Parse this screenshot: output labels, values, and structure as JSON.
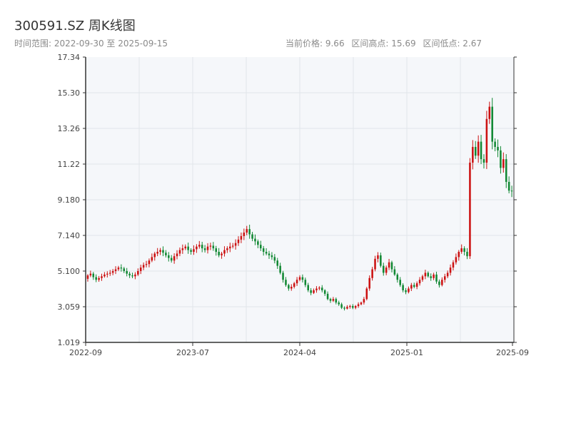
{
  "header": {
    "title": "300591.SZ 周K线图",
    "date_range_label": "时间范围: 2022-09-30 至 2025-09-15",
    "current_price": "当前价格: 9.66",
    "range_high": "区间高点: 15.69",
    "range_low": "区间低点: 2.67"
  },
  "colors": {
    "up": "#cc1111",
    "down": "#118833",
    "plot_bg": "#f5f7fa",
    "grid": "#e1e5ea",
    "axis": "#333333",
    "text": "#444444"
  },
  "chart_data": {
    "type": "candlestick",
    "title": "300591.SZ 周K线图",
    "xlabel": "",
    "ylabel": "",
    "ylim": [
      1.019,
      17.34
    ],
    "y_ticks": [
      "1.019",
      "3.059",
      "5.100",
      "7.140",
      "9.180",
      "11.22",
      "13.26",
      "15.30",
      "17.34"
    ],
    "x_ticks": [
      "2022-09",
      "2023-07",
      "2024-04",
      "2025-01",
      "2025-09"
    ],
    "grid": true,
    "series": [
      {
        "close": [
          4.85,
          4.95,
          4.75,
          4.6,
          4.7,
          4.8,
          4.9,
          4.95,
          5.0,
          5.1,
          5.2,
          5.3,
          5.25,
          5.1,
          4.95,
          4.85,
          4.8,
          4.9,
          5.1,
          5.3,
          5.45,
          5.5,
          5.7,
          5.9,
          6.1,
          6.2,
          6.3,
          6.15,
          6.0,
          5.85,
          5.7,
          5.95,
          6.1,
          6.3,
          6.4,
          6.5,
          6.3,
          6.2,
          6.35,
          6.5,
          6.6,
          6.4,
          6.3,
          6.5,
          6.55,
          6.4,
          6.2,
          6.0,
          6.1,
          6.3,
          6.4,
          6.5,
          6.55,
          6.7,
          6.9,
          7.1,
          7.3,
          7.5,
          7.2,
          6.95,
          6.8,
          6.6,
          6.4,
          6.2,
          6.1,
          6.0,
          5.9,
          5.7,
          5.4,
          5.0,
          4.6,
          4.3,
          4.1,
          4.2,
          4.4,
          4.6,
          4.75,
          4.6,
          4.3,
          4.0,
          3.85,
          4.0,
          4.1,
          4.15,
          4.0,
          3.8,
          3.5,
          3.4,
          3.5,
          3.3,
          3.2,
          3.0,
          2.95,
          3.05,
          3.1,
          3.0,
          3.1,
          3.2,
          3.3,
          3.5,
          4.1,
          4.7,
          5.2,
          5.8,
          6.0,
          5.4,
          5.0,
          5.3,
          5.6,
          5.2,
          4.9,
          4.6,
          4.3,
          4.0,
          3.9,
          4.1,
          4.3,
          4.2,
          4.4,
          4.6,
          4.8,
          5.0,
          4.8,
          4.7,
          4.9,
          4.5,
          4.3,
          4.6,
          4.8,
          5.0,
          5.3,
          5.6,
          5.9,
          6.2,
          6.4,
          6.2,
          5.95,
          11.3,
          12.2,
          11.7,
          12.5,
          11.5,
          11.3,
          13.8,
          14.5,
          12.5,
          12.2,
          12.0,
          11.0,
          11.5,
          10.2,
          9.7,
          9.66
        ]
      }
    ]
  }
}
